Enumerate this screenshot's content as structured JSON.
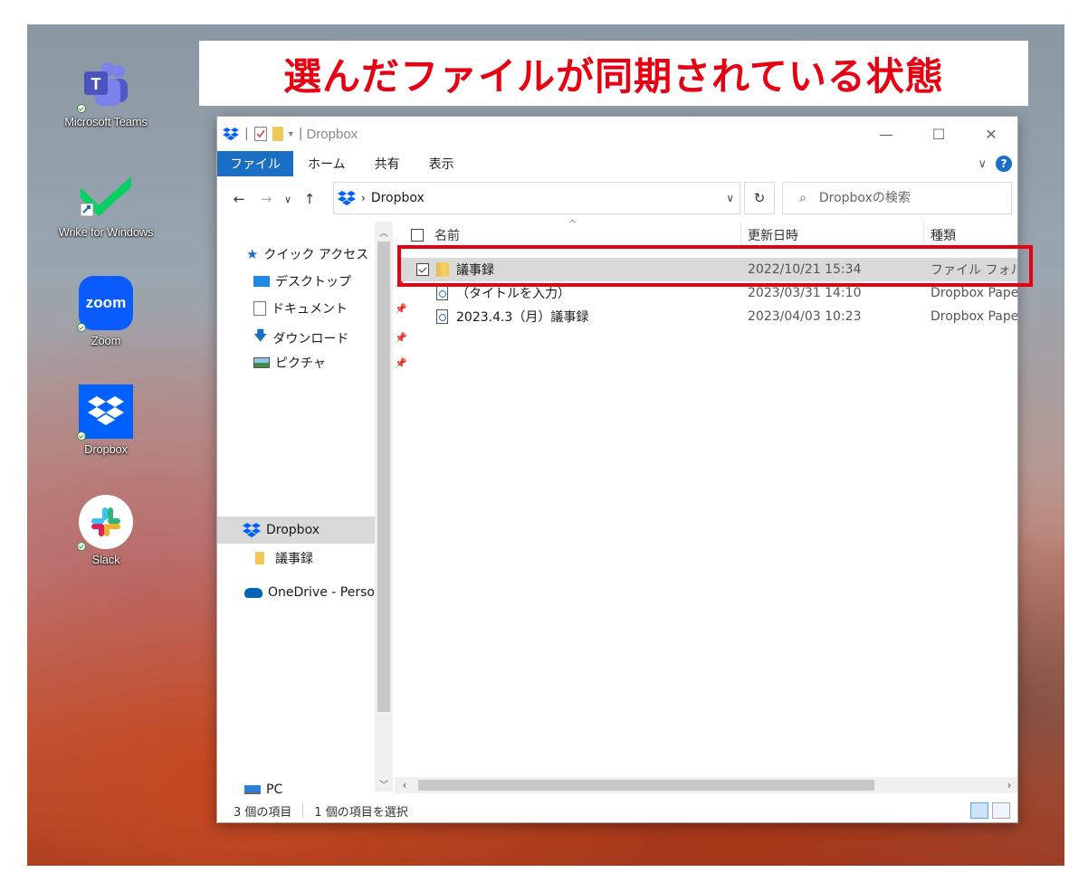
{
  "banner": {
    "text": "選んだファイルが同期されている状態"
  },
  "desktop_icons": [
    {
      "label": "Microsoft Teams"
    },
    {
      "label": "Wrike for Windows"
    },
    {
      "label": "Zoom",
      "tile_text": "zoom"
    },
    {
      "label": "Dropbox"
    },
    {
      "label": "Slack"
    }
  ],
  "window": {
    "title": "Dropbox",
    "ribbon_tabs": [
      "ファイル",
      "ホーム",
      "共有",
      "表示"
    ],
    "help_glyph": "?",
    "address": {
      "crumb": "Dropbox"
    },
    "search": {
      "placeholder": "Dropboxの検索"
    },
    "nav": {
      "quick_access": "クイック アクセス",
      "items": [
        "デスクトップ",
        "ドキュメント",
        "ダウンロード",
        "ピクチャ"
      ],
      "dropbox": "Dropbox",
      "dropbox_child": "議事録",
      "onedrive": "OneDrive - Persor",
      "pc": "PC"
    },
    "columns": {
      "name": "名前",
      "date": "更新日時",
      "type": "種類"
    },
    "rows": [
      {
        "name": "議事録",
        "date": "2022/10/21 15:34",
        "type": "ファイル フォルダー",
        "icon": "folder-icon",
        "selected": true
      },
      {
        "name": "（タイトルを入力）",
        "date": "2023/03/31 14:10",
        "type": "Dropbox Paper",
        "icon": "dropbox-paper-icon",
        "selected": false
      },
      {
        "name": "2023.4.3（月）議事録",
        "date": "2023/04/03 10:23",
        "type": "Dropbox Paper",
        "icon": "dropbox-paper-icon",
        "selected": false
      }
    ],
    "status": {
      "count": "3 個の項目",
      "selected": "1 個の項目を選択"
    }
  },
  "colors": {
    "accent": "#1a6fc4",
    "highlight": "#e60012",
    "dropbox": "#0061fe"
  }
}
